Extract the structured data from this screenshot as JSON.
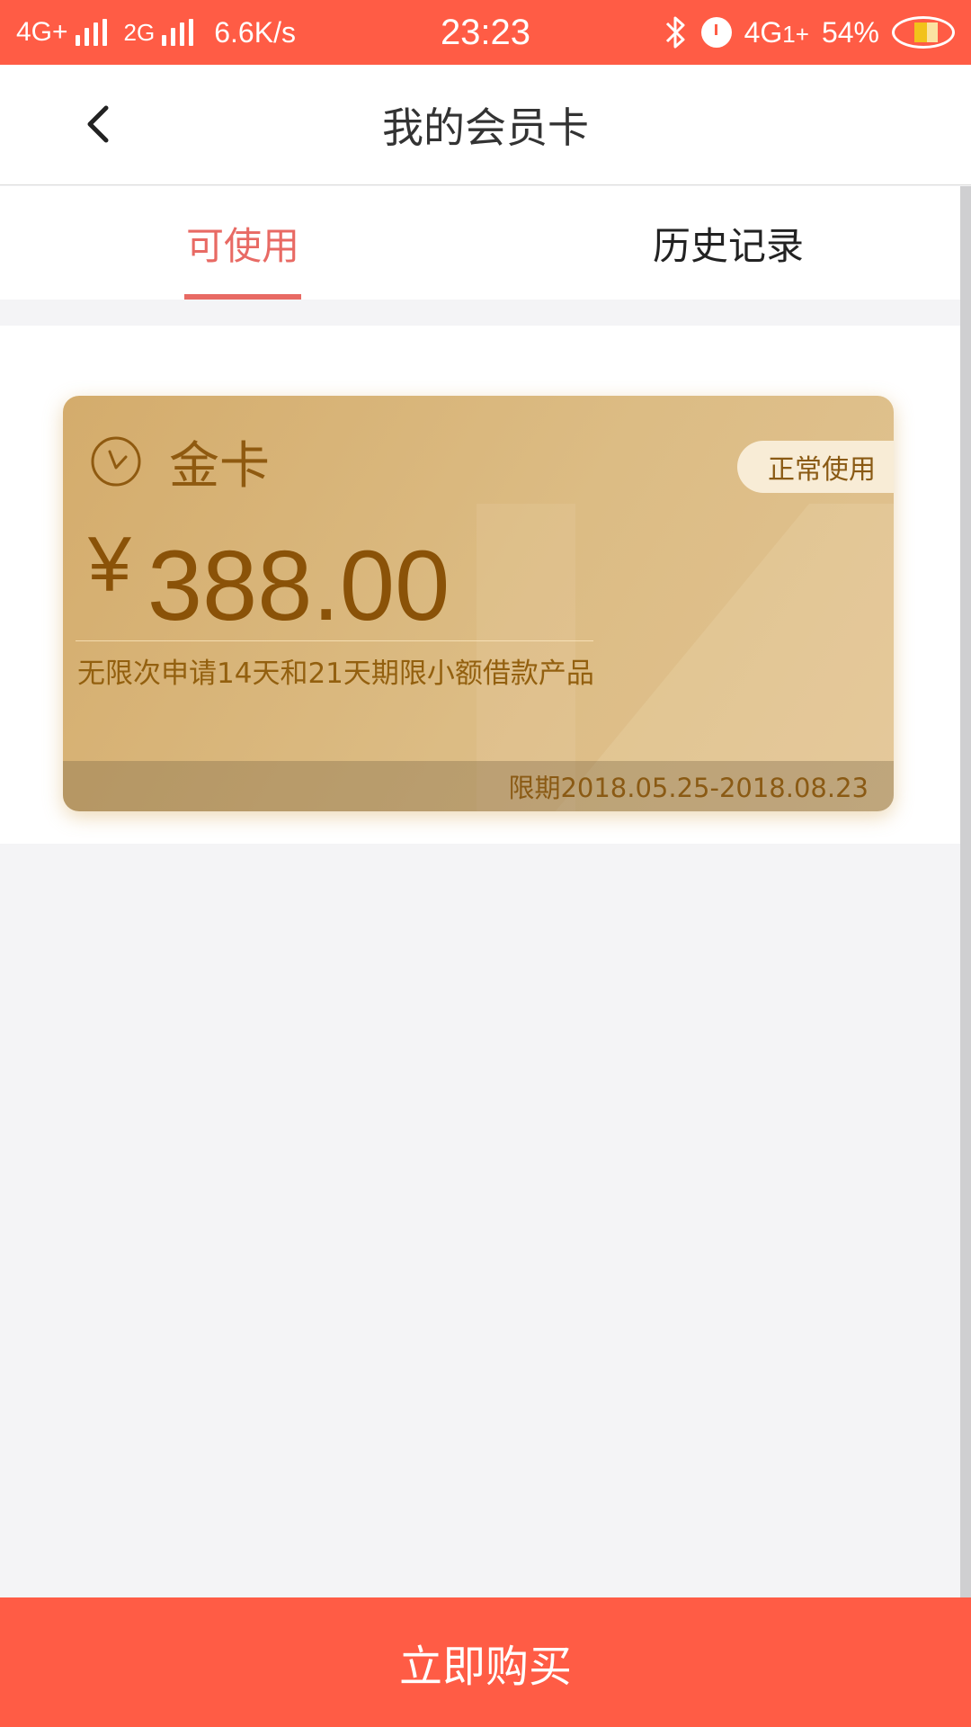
{
  "status_bar": {
    "net1": "4G+",
    "net2": "2G",
    "speed": "6.6K/s",
    "time": "23:23",
    "bluetooth_icon": "bluetooth-icon",
    "alarm_icon": "alarm-icon",
    "net3": "4G",
    "net3_suffix": "1+",
    "battery": "54%"
  },
  "nav": {
    "back_icon": "chevron-left-icon",
    "title": "我的会员卡"
  },
  "tabs": [
    {
      "label": "可使用",
      "active": true
    },
    {
      "label": "历史记录",
      "active": false
    }
  ],
  "card": {
    "icon": "clock-icon",
    "name": "金卡",
    "status": "正常使用",
    "currency": "¥",
    "amount": "388.00",
    "description": "无限次申请14天和21天期限小额借款产品",
    "validity": "限期2018.05.25-2018.08.23"
  },
  "footer": {
    "buy_label": "立即购买"
  },
  "colors": {
    "accent": "#ff5c45",
    "tab_active": "#e86a64",
    "card_gold": "#d9b67c",
    "card_text": "#8a5208"
  }
}
